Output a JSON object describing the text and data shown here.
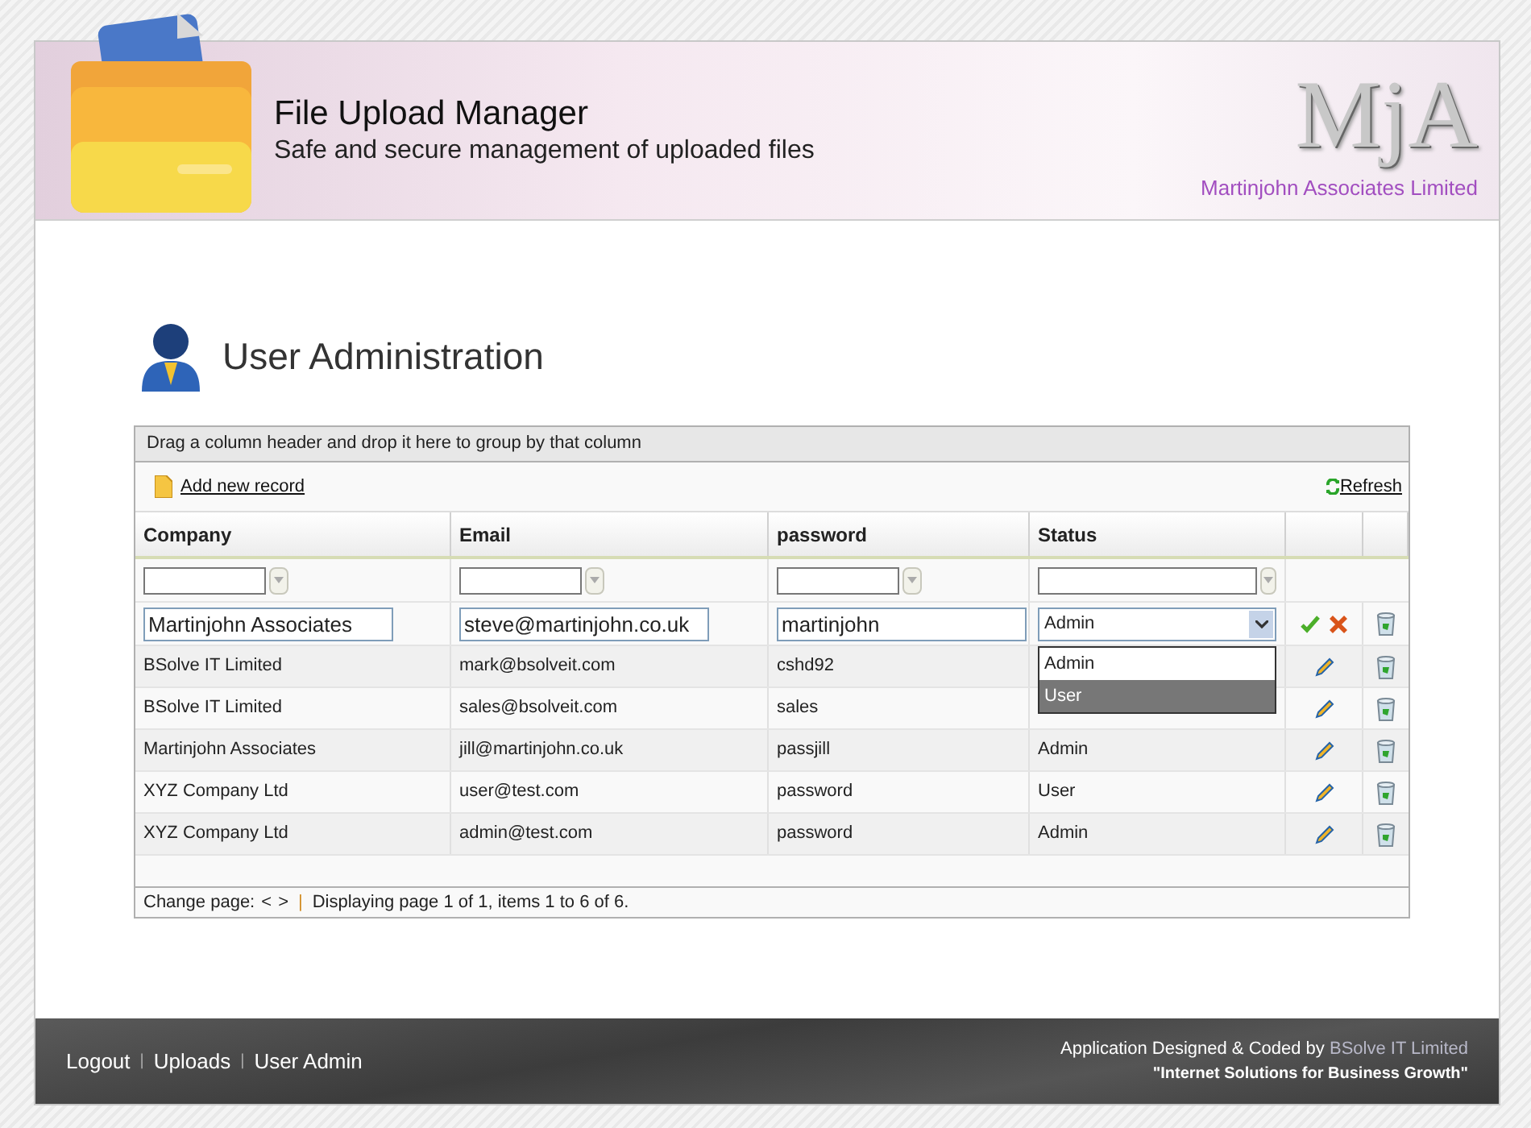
{
  "header": {
    "title": "File Upload Manager",
    "subtitle": "Safe and secure management of uploaded files",
    "logo": "MjA",
    "company": "Martinjohn Associates Limited"
  },
  "page_title": "User Administration",
  "grid": {
    "group_hint": "Drag a column header and drop it here to group by that column",
    "add_label": "Add new record",
    "refresh_label": "Refresh",
    "columns": [
      "Company",
      "Email",
      "password",
      "Status"
    ],
    "edit_row": {
      "company": "Martinjohn Associates",
      "email": "steve@martinjohn.co.uk",
      "password": "martinjohn",
      "status": "Admin"
    },
    "status_options": [
      {
        "label": "Admin",
        "highlighted": false
      },
      {
        "label": "User",
        "highlighted": true
      }
    ],
    "rows": [
      {
        "company": "BSolve IT Limited",
        "email": "mark@bsolveit.com",
        "password": "cshd92"
      },
      {
        "company": "BSolve IT Limited",
        "email": "sales@bsolveit.com",
        "password": "sales"
      },
      {
        "company": "Martinjohn Associates",
        "email": "jill@martinjohn.co.uk",
        "password": "passjill",
        "status": "Admin"
      },
      {
        "company": "XYZ Company Ltd",
        "email": "user@test.com",
        "password": "password",
        "status": "User"
      },
      {
        "company": "XYZ Company Ltd",
        "email": "admin@test.com",
        "password": "password",
        "status": "Admin"
      }
    ],
    "pager": {
      "label": "Change page:",
      "prev": "<",
      "next": ">",
      "separator": "|",
      "info": "Displaying page 1 of 1, items 1 to 6 of 6."
    }
  },
  "footer": {
    "links": [
      "Logout",
      "Uploads",
      "User Admin"
    ],
    "separator": "|",
    "credit": "Application Designed & Coded by",
    "credit_link": "BSolve IT Limited",
    "tagline": "\"Internet Solutions for Business Growth\""
  }
}
